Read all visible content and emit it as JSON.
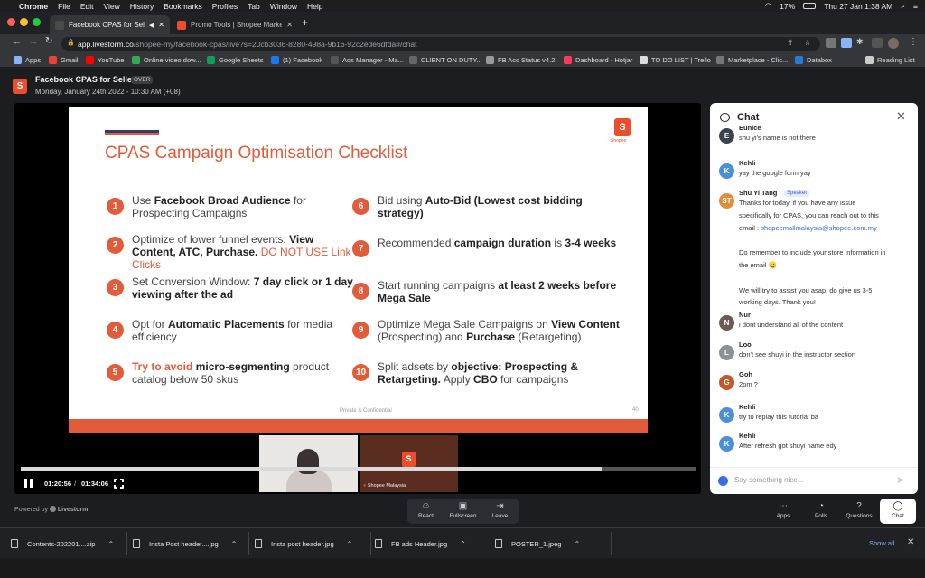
{
  "menubar": {
    "items": [
      "Chrome",
      "File",
      "Edit",
      "View",
      "History",
      "Bookmarks",
      "Profiles",
      "Tab",
      "Window",
      "Help"
    ],
    "battery": "17%",
    "clock": "Thu 27 Jan  1:38 AM"
  },
  "tabs": [
    {
      "label": "Facebook CPAS for Sellers",
      "active": true
    },
    {
      "label": "Promo Tools | Shopee Marketplace",
      "active": false
    }
  ],
  "address": {
    "host": "app.livestorm.co",
    "path": "/shopee-my/facebook-cpas/live?s=20cb3036-8280-498a-9b16-92c2ede6dfda#/chat"
  },
  "bookmarks": [
    {
      "label": "Apps",
      "color": "#8ab4f8"
    },
    {
      "label": "Gmail",
      "color": "#ea4335"
    },
    {
      "label": "YouTube",
      "color": "#ff0000"
    },
    {
      "label": "Online video dow...",
      "color": "#34a853"
    },
    {
      "label": "Google Sheets",
      "color": "#0f9d58"
    },
    {
      "label": "(1) Facebook",
      "color": "#1877f2"
    },
    {
      "label": "Ads Manager - Ma...",
      "color": "#555555"
    },
    {
      "label": "CLIENT ON DUTY...",
      "color": "#666666"
    },
    {
      "label": "FB Acc Status v4.2",
      "color": "#999999"
    },
    {
      "label": "Dashboard - Hotjar",
      "color": "#fd3a5c"
    },
    {
      "label": "TO DO LIST | Trello",
      "color": "#dddddd"
    },
    {
      "label": "Marketplace - Clic...",
      "color": "#777777"
    },
    {
      "label": "Databox",
      "color": "#2a7bd5"
    },
    {
      "label": "Reading List",
      "color": "#cccccc"
    }
  ],
  "event": {
    "title": "Facebook CPAS for Sellers",
    "badge": "OVER",
    "date": "Monday, January 24th 2022 - 10:30 AM (+08)"
  },
  "slide": {
    "title": "CPAS Campaign Optimisation Checklist",
    "logo_text": "Shopee",
    "footer": "Private & Confidential",
    "page": "40",
    "items": [
      {
        "n": "1",
        "parts": [
          {
            "t": "Use ",
            "s": ""
          },
          {
            "t": "Facebook Broad Audience",
            "s": "b"
          },
          {
            "t": " for Prospecting Campaigns",
            "s": ""
          }
        ]
      },
      {
        "n": "2",
        "parts": [
          {
            "t": "Optimize of lower funnel events: ",
            "s": ""
          },
          {
            "t": "View Content, ATC, Purchase.",
            "s": "b"
          },
          {
            "t": " DO NOT USE Link Clicks",
            "s": "r"
          }
        ]
      },
      {
        "n": "3",
        "parts": [
          {
            "t": "Set Conversion Window: ",
            "s": ""
          },
          {
            "t": "7 day click or 1 day viewing after the ad",
            "s": "b"
          }
        ]
      },
      {
        "n": "4",
        "parts": [
          {
            "t": "Opt for ",
            "s": ""
          },
          {
            "t": "Automatic Placements",
            "s": "b"
          },
          {
            "t": " for media efficiency",
            "s": ""
          }
        ]
      },
      {
        "n": "5",
        "parts": [
          {
            "t": "Try to avoid",
            "s": "rb"
          },
          {
            "t": " ",
            "s": ""
          },
          {
            "t": "micro-segmenting",
            "s": "b"
          },
          {
            "t": " product catalog below 50 skus",
            "s": ""
          }
        ]
      },
      {
        "n": "6",
        "parts": [
          {
            "t": "Bid using ",
            "s": ""
          },
          {
            "t": "Auto-Bid (Lowest cost bidding strategy)",
            "s": "b"
          }
        ]
      },
      {
        "n": "7",
        "parts": [
          {
            "t": "Recommended ",
            "s": ""
          },
          {
            "t": "campaign duration",
            "s": "b"
          },
          {
            "t": " is ",
            "s": ""
          },
          {
            "t": "3-4 weeks",
            "s": "b"
          }
        ]
      },
      {
        "n": "8",
        "parts": [
          {
            "t": "Start running campaigns ",
            "s": ""
          },
          {
            "t": "at least 2 weeks before Mega Sale",
            "s": "b"
          }
        ]
      },
      {
        "n": "9",
        "parts": [
          {
            "t": "Optimize Mega Sale Campaigns on ",
            "s": ""
          },
          {
            "t": "View Content",
            "s": "b"
          },
          {
            "t": " (Prospecting) and ",
            "s": ""
          },
          {
            "t": "Purchase",
            "s": "b"
          },
          {
            "t": " (Retargeting)",
            "s": ""
          }
        ]
      },
      {
        "n": "10",
        "parts": [
          {
            "t": "Split adsets by ",
            "s": ""
          },
          {
            "t": "objective: Prospecting & Retargeting.",
            "s": "b"
          },
          {
            "t": " Apply ",
            "s": ""
          },
          {
            "t": "CBO",
            "s": "b"
          },
          {
            "t": " for campaigns",
            "s": ""
          }
        ]
      }
    ]
  },
  "thumbs": {
    "presenter_label": "Shopee Malaysia"
  },
  "player": {
    "current_time": "01:20:56",
    "separator": "/",
    "duration": "01:34:06",
    "progress_fraction": 0.86
  },
  "chat": {
    "title": "Chat",
    "speaker_badge": "Speaker",
    "messages": [
      {
        "name": "Eunice",
        "initial": "E",
        "color": "#3d4250",
        "lines": [
          "shu yi's name is not there"
        ]
      },
      {
        "name": "Kehli",
        "initial": "K",
        "color": "#4a90d9",
        "lines": [
          "yay the google form yay"
        ]
      },
      {
        "name": "Shu Yi Tang",
        "initial": "ST",
        "color": "#e38b3c",
        "speaker": true,
        "lines": [
          "Thanks for today, if you have any issue",
          "specifically for CPAS, you can reach out to this",
          "email : shopeemallmalaysia@shopee.com.my",
          "",
          "Do remember to include your store information in",
          "the email 😀",
          "",
          "We will try to assist you asap, do give us 3-5",
          "working days. Thank you!"
        ]
      },
      {
        "name": "Nur",
        "initial": "N",
        "color": "#6b5a55",
        "lines": [
          "i dont understand all of the content"
        ]
      },
      {
        "name": "Loo",
        "initial": "L",
        "color": "#8a9296",
        "lines": [
          "don't see shuyi in the instructor section"
        ]
      },
      {
        "name": "Goh",
        "initial": "G",
        "color": "#c8582a",
        "lines": [
          "2pm ?"
        ]
      },
      {
        "name": "Kehli",
        "initial": "K",
        "color": "#4a90d9",
        "lines": [
          "try to replay this tutorial ba"
        ]
      },
      {
        "name": "Kehli",
        "initial": "K",
        "color": "#4a90d9",
        "lines": [
          "After refresh got shuyi name edy"
        ]
      }
    ],
    "email": "shopeemallmalaysia@shopee.com.my",
    "input_placeholder": "Say something nice..."
  },
  "footer": {
    "powered_by": "Powered by",
    "brand": "Livestorm",
    "controls": [
      "React",
      "Fullscreen",
      "Leave"
    ],
    "right_controls": [
      "Apps",
      "Polls",
      "Questions",
      "Chat"
    ]
  },
  "downloads": {
    "files": [
      "Contents-202201....zip",
      "Insta Post header....jpg",
      "Insta post header.jpg",
      "FB ads Header.jpg",
      "POSTER_1.jpeg"
    ],
    "show_all": "Show all"
  }
}
